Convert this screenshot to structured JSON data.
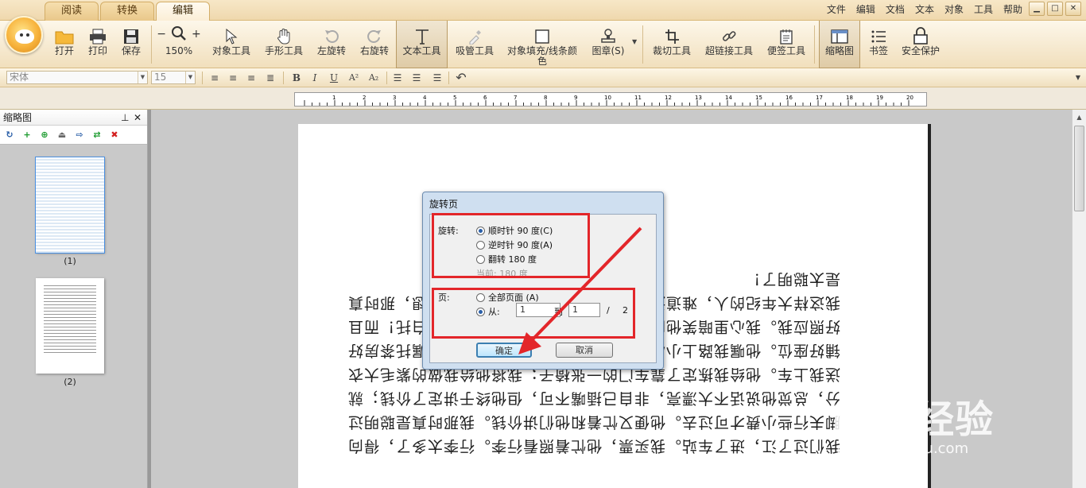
{
  "tabs": [
    "阅读",
    "转换",
    "编辑"
  ],
  "menu": [
    "文件",
    "编辑",
    "文档",
    "文本",
    "对象",
    "工具",
    "帮助"
  ],
  "ribbon": {
    "open": "打开",
    "print": "打印",
    "save": "保存",
    "zoom": "150%",
    "zoom_out": "−",
    "zoom_in": "+",
    "object_tool": "对象工具",
    "hand_tool": "手形工具",
    "rotate_left": "左旋转",
    "rotate_right": "右旋转",
    "text_tool": "文本工具",
    "eyedropper": "吸管工具",
    "fill_stroke_line1": "对象填充/线条颜",
    "fill_stroke_line2": "色",
    "stamp": "图章(S)",
    "crop": "裁切工具",
    "hyperlink": "超链接工具",
    "note": "便签工具",
    "thumbnail": "缩略图",
    "bookmark": "书签",
    "security": "安全保护"
  },
  "format": {
    "font_name": "宋体",
    "font_size": "15",
    "bold": "B",
    "italic": "I",
    "underline": "U",
    "superscript": "A²",
    "subscript": "A₂"
  },
  "ruler_ticks": [
    "1",
    "2",
    "3",
    "4",
    "5",
    "6",
    "7",
    "8",
    "9",
    "10",
    "11",
    "12",
    "13",
    "14",
    "15",
    "16",
    "17",
    "18",
    "19",
    "20"
  ],
  "thumb_panel": {
    "title": "缩略图",
    "pages": [
      "(1)",
      "(2)"
    ]
  },
  "page_lines": [
    "我们过了江，进了车站。我买票，他忙着照看行李。行李太多了，得向",
    "脚夫行些小费才可过去。他便又忙着和他们讲价钱。我那时真是聪明过",
    "分，总觉他说话不大漂亮，非自己插嘴不可，但他终于讲定了价钱；就",
    "送我上车。他给我拣定了靠车门的一张椅子；我将他给我做的紫毛大衣",
    "铺好座位。他嘱我路上小心，夜里要警醒些，不要受凉。又嘱托茶房好",
    "好照应我。我心里暗笑他的迂；他们只认得钱，托他们直是白托！而且",
    "我这样大年纪的人，难道还不能料理自己么？唉，我现在想想，那时真",
    "是太聪明了！"
  ],
  "dialog": {
    "title": "旋转页",
    "rotate_label": "旋转:",
    "option_cw": "顺时针 90 度(C)",
    "option_ccw": "逆时针 90 度(A)",
    "option_flip": "翻转 180 度",
    "current": "当前:   180 度",
    "pages_label": "页:",
    "all_pages": "全部页面 (A)",
    "from_label": "从:",
    "from_value": "1",
    "to_label": "到",
    "to_value": "1",
    "slash": "/",
    "total": "2",
    "ok": "确定",
    "cancel": "取消"
  },
  "watermark": {
    "brand": "Bai 经验",
    "url": "jingyan.baidu.com"
  },
  "colors": {
    "accent": "#e3262a",
    "ribbon": "#f1dfbc",
    "dialog_frame": "#cfdff0"
  }
}
